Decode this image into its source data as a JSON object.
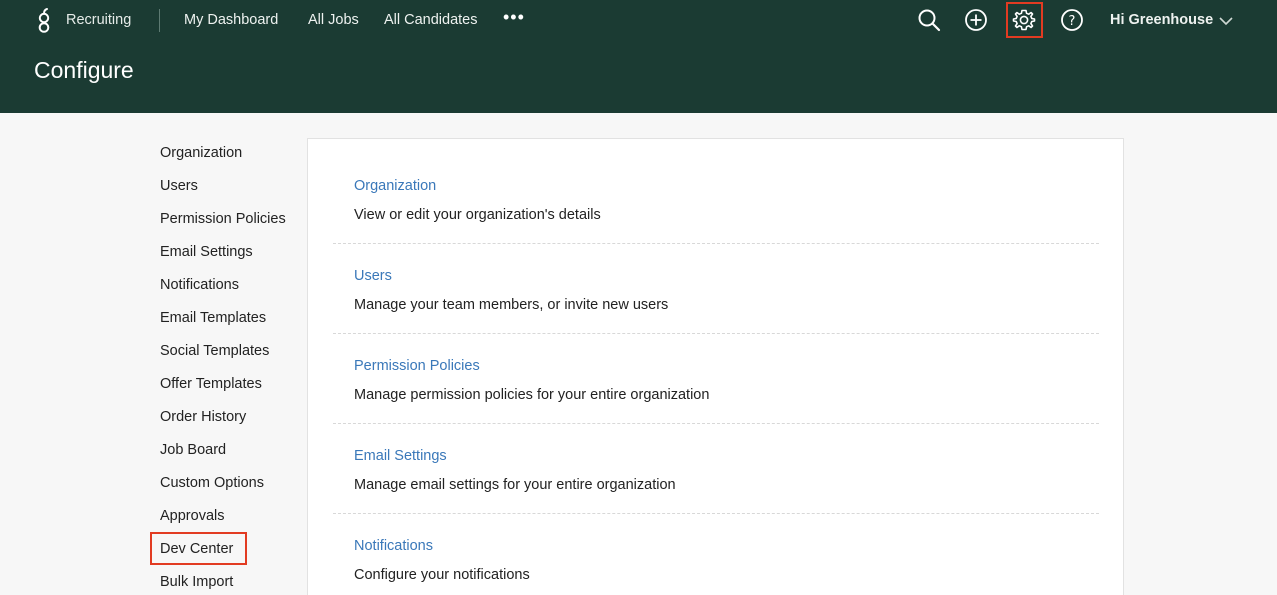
{
  "header": {
    "brand": "Recruiting",
    "nav": [
      "My Dashboard",
      "All Jobs",
      "All Candidates"
    ],
    "more": "•••",
    "user_greeting": "Hi Greenhouse",
    "page_title": "Configure",
    "icons": [
      "search-icon",
      "add-icon",
      "gear-icon",
      "help-icon",
      "chevron-down-icon"
    ],
    "bg_color": "#1b3b33",
    "highlight_color": "#e23b22"
  },
  "sidebar": {
    "items": [
      "Organization",
      "Users",
      "Permission Policies",
      "Email Settings",
      "Notifications",
      "Email Templates",
      "Social Templates",
      "Offer Templates",
      "Order History",
      "Job Board",
      "Custom Options",
      "Approvals",
      "Dev Center",
      "Bulk Import"
    ]
  },
  "main": {
    "sections": [
      {
        "title": "Organization",
        "description": "View or edit your organization's details"
      },
      {
        "title": "Users",
        "description": "Manage your team members, or invite new users"
      },
      {
        "title": "Permission Policies",
        "description": "Manage permission policies for your entire organization"
      },
      {
        "title": "Email Settings",
        "description": "Manage email settings for your entire organization"
      },
      {
        "title": "Notifications",
        "description": "Configure your notifications"
      }
    ],
    "link_color": "#3a78b9"
  }
}
